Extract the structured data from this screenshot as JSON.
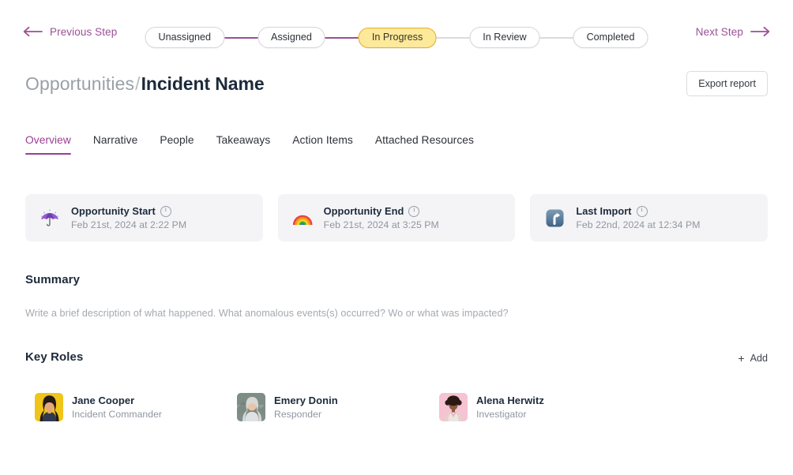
{
  "stepper": {
    "prev_label": "Previous Step",
    "next_label": "Next Step",
    "steps": [
      {
        "label": "Unassigned",
        "state": "done"
      },
      {
        "label": "Assigned",
        "state": "done"
      },
      {
        "label": "In Progress",
        "state": "active"
      },
      {
        "label": "In Review",
        "state": "upcoming"
      },
      {
        "label": "Completed",
        "state": "upcoming"
      }
    ],
    "active_color": "#fde99a",
    "active_border": "#e8ab2e",
    "accent_color": "#9b4f96"
  },
  "header": {
    "breadcrumb_parent": "Opportunities",
    "breadcrumb_separator": "/",
    "breadcrumb_current": "Incident Name",
    "export_label": "Export report"
  },
  "tabs": [
    {
      "label": "Overview",
      "active": true
    },
    {
      "label": "Narrative",
      "active": false
    },
    {
      "label": "People",
      "active": false
    },
    {
      "label": "Takeaways",
      "active": false
    },
    {
      "label": "Action Items",
      "active": false
    },
    {
      "label": "Attached Resources",
      "active": false
    }
  ],
  "cards": [
    {
      "icon": "umbrella-with-rain-emoji",
      "label": "Opportunity Start",
      "date": "Feb 21st, 2024 at 2:22 PM"
    },
    {
      "icon": "rainbow-emoji",
      "label": "Opportunity End",
      "date": "Feb 21st, 2024 at 3:25 PM"
    },
    {
      "icon": "arrow-heading-up-emoji",
      "label": "Last Import",
      "date": "Feb 22nd, 2024 at 12:34 PM"
    }
  ],
  "summary": {
    "heading": "Summary",
    "placeholder": "Write a brief description of what happened. What anomalous events(s) occurred? Wo or what was impacted?"
  },
  "key_roles": {
    "heading": "Key Roles",
    "add_label": "Add",
    "add_icon": "plus-icon",
    "people": [
      {
        "name": "Jane Cooper",
        "role": "Incident Commander",
        "avatar_bg": "#f0c419"
      },
      {
        "name": "Emery Donin",
        "role": "Responder",
        "avatar_bg": "#8d9aa0"
      },
      {
        "name": "Alena Herwitz",
        "role": "Investigator",
        "avatar_bg": "#f6c3d3"
      }
    ]
  }
}
